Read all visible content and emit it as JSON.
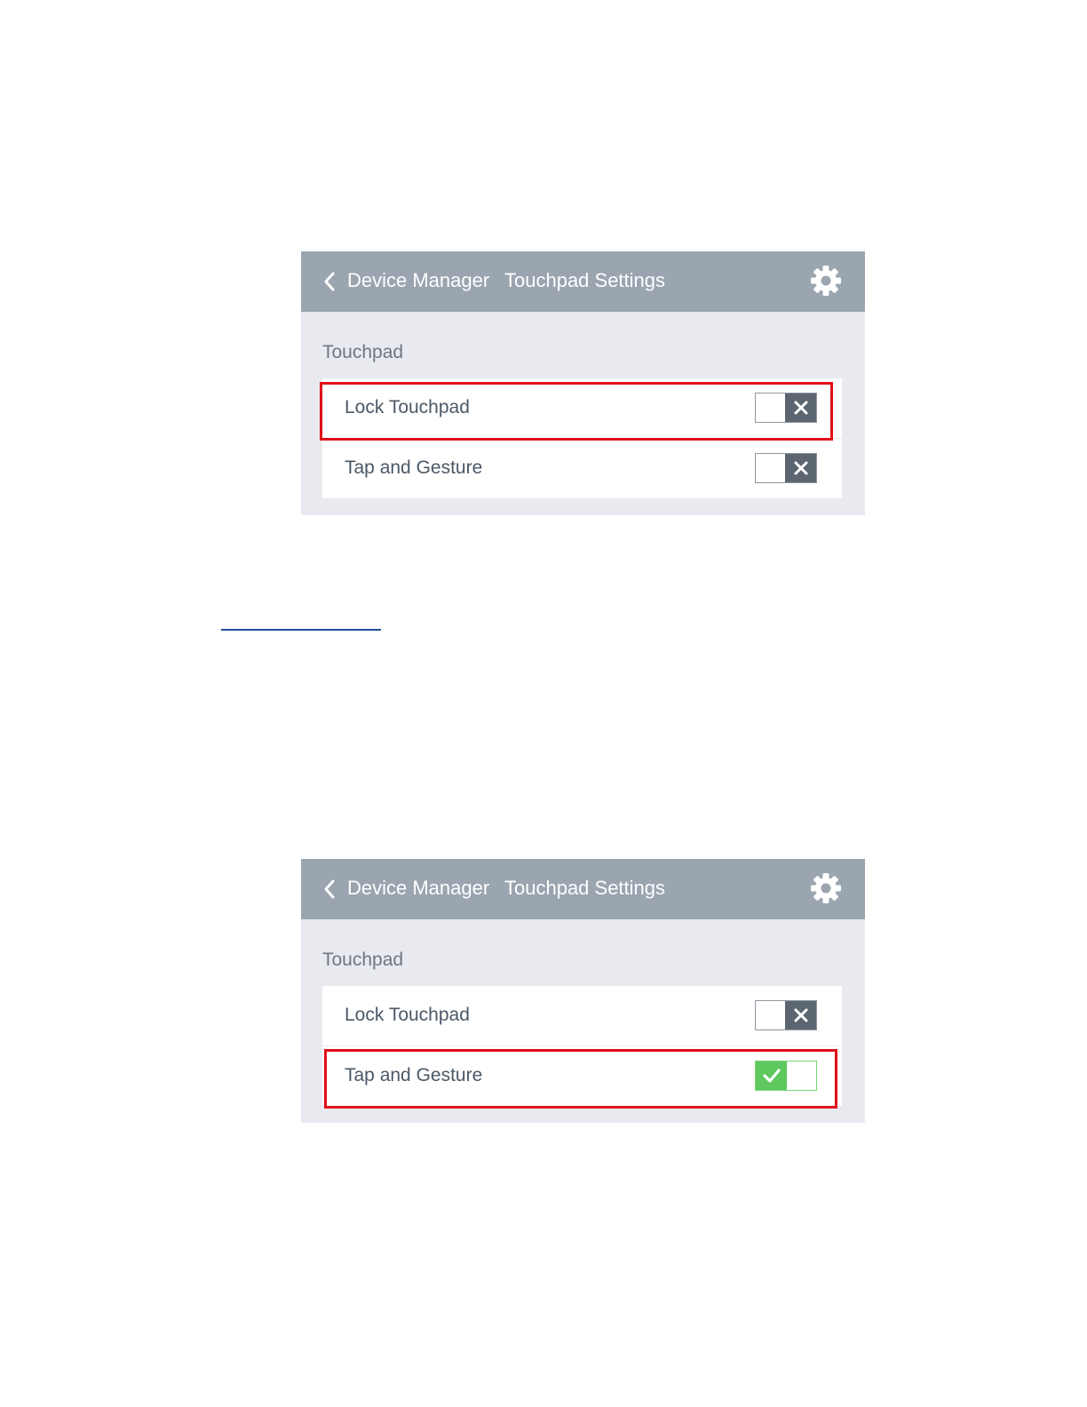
{
  "screens": [
    {
      "header": {
        "back_label": "Device Manager",
        "title": "Touchpad Settings"
      },
      "section_title": "Touchpad",
      "rows": [
        {
          "label": "Lock Touchpad",
          "state": "off"
        },
        {
          "label": "Tap and Gesture",
          "state": "off"
        }
      ],
      "highlighted_row": "Lock Touchpad"
    },
    {
      "header": {
        "back_label": "Device Manager",
        "title": "Touchpad Settings"
      },
      "section_title": "Touchpad",
      "rows": [
        {
          "label": "Lock Touchpad",
          "state": "off"
        },
        {
          "label": "Tap and Gesture",
          "state": "on"
        }
      ],
      "highlighted_row": "Tap and Gesture"
    }
  ],
  "icons": {
    "back": "chevron-left-icon",
    "settings": "gear-icon",
    "toggle_off": "x-icon",
    "toggle_on": "checkmark-icon"
  },
  "colors": {
    "header_bg": "#9aa5b0",
    "panel_bg": "#e9eaf0",
    "highlight": "#e0101a",
    "toggle_off_knob": "#5c6670",
    "toggle_on_knob": "#5ec75e",
    "link_underline": "#1e4f9a"
  }
}
